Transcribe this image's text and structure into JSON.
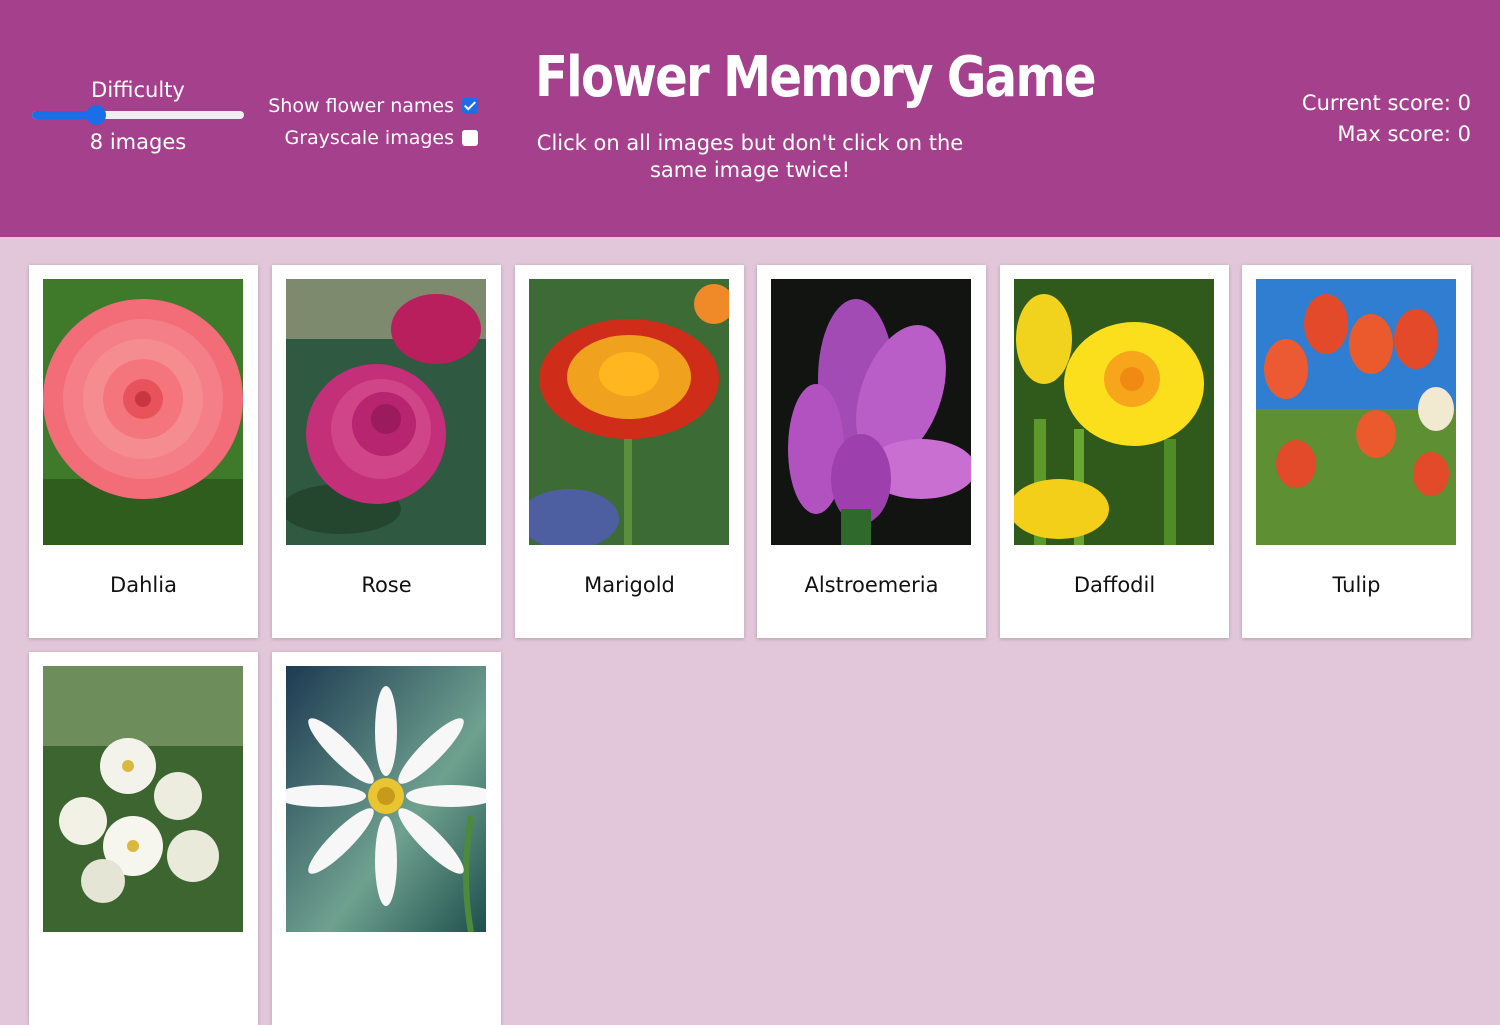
{
  "header": {
    "title": "Flower Memory Game",
    "subtitle": "Click on all images but don't click on the same image twice!",
    "background": "#a5418c"
  },
  "difficulty": {
    "label": "Difficulty",
    "count_label": "8 images",
    "slider_level": 0.3
  },
  "options": {
    "show_names": {
      "label": "Show flower names",
      "checked": true
    },
    "grayscale": {
      "label": "Grayscale images",
      "checked": false
    }
  },
  "scores": {
    "current": "Current score: 0",
    "max": "Max score: 0"
  },
  "cards": [
    {
      "name": "Dahlia",
      "icon": "dahlia-image"
    },
    {
      "name": "Rose",
      "icon": "rose-image"
    },
    {
      "name": "Marigold",
      "icon": "marigold-image"
    },
    {
      "name": "Alstroemeria",
      "icon": "alstroemeria-image"
    },
    {
      "name": "Daffodil",
      "icon": "daffodil-image"
    },
    {
      "name": "Tulip",
      "icon": "tulip-image"
    },
    {
      "name": "",
      "icon": "jasmine-image"
    },
    {
      "name": "",
      "icon": "daisy-image"
    }
  ],
  "colors": {
    "page_background": "#e1c7d9",
    "accent": "#1a6fe9"
  }
}
